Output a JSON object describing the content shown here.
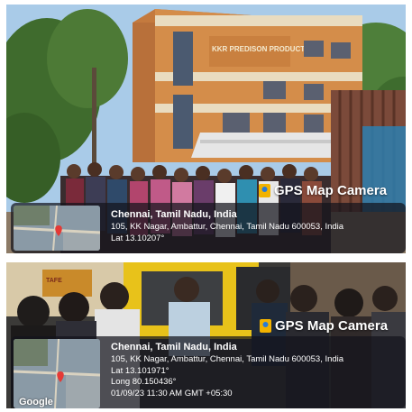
{
  "photos": [
    {
      "badge": "GPS Map Camera",
      "sign": "KKR PREDISON PRODUCTS",
      "city": "Chennai, Tamil Nadu, India",
      "address": "105, KK Nagar, Ambattur, Chennai, Tamil Nadu 600053, India",
      "lat": "Lat 13.10207°"
    },
    {
      "badge": "GPS Map Camera",
      "city": "Chennai, Tamil Nadu, India",
      "address": "105, KK Nagar, Ambattur, Chennai, Tamil Nadu 600053, India",
      "lat": "Lat 13.101971°",
      "long": "Long 80.150436°",
      "datetime": "01/09/23 11:30 AM GMT +05:30",
      "map_brand": "Google"
    }
  ],
  "icons": {
    "badge": "map-pin-icon",
    "marker": "location-marker-icon"
  },
  "colors": {
    "badge_pin": "#f2b200",
    "marker": "#e53935",
    "sky": "#a9cbe8"
  }
}
